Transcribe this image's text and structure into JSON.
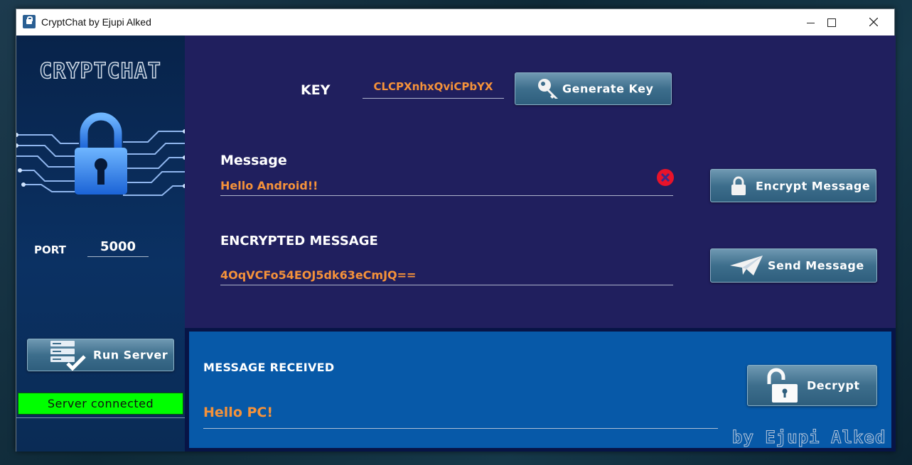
{
  "window": {
    "title": "CryptChat by Ejupi Alked"
  },
  "sidebar": {
    "logo_text": "CRYPTCHAT",
    "port_label": "PORT",
    "port_value": "5000",
    "run_server_label": "Run Server",
    "status_text": "Server connected",
    "status_color": "#00ff00"
  },
  "main": {
    "key_label": "KEY",
    "key_value": "CLCPXnhxQviCPbYX",
    "generate_key_label": "Generate Key",
    "message_label": "Message",
    "message_value": "Hello Android!!",
    "encrypt_label": "Encrypt Message",
    "encrypted_label": "ENCRYPTED MESSAGE",
    "encrypted_value": "4OqVCFo54EOJ5dk63eCmJQ==",
    "send_label": "Send Message"
  },
  "received": {
    "label": "MESSAGE RECEIVED",
    "value": "Hello PC!",
    "decrypt_label": "Decrypt",
    "signature": "by Ejupi Alked"
  },
  "colors": {
    "accent_text": "#f5923a",
    "main_bg": "#201f5e",
    "received_bg": "#0759a8"
  }
}
